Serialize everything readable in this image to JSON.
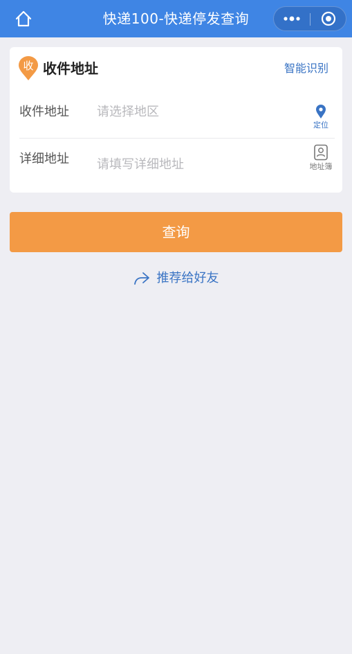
{
  "nav": {
    "title": "快递100-快递停发查询",
    "home_icon": "home-icon",
    "more_icon": "more-dots-icon",
    "close_icon": "target-close-icon"
  },
  "card": {
    "badge_text": "收",
    "title": "收件地址",
    "smart_label": "智能识别",
    "rows": [
      {
        "label": "收件地址",
        "placeholder": "请选择地区",
        "tool_label": "定位",
        "tool_icon": "location-pin-icon"
      },
      {
        "label": "详细地址",
        "placeholder": "请填写详细地址",
        "tool_label": "地址簿",
        "tool_icon": "address-book-icon"
      }
    ]
  },
  "query_label": "查询",
  "share": {
    "label": "推荐给好友",
    "icon": "share-arrow-icon"
  },
  "colors": {
    "nav_bg": "#3f85e4",
    "accent_orange": "#f39a45",
    "link_blue": "#3a74c4",
    "page_bg": "#eeeef3"
  }
}
